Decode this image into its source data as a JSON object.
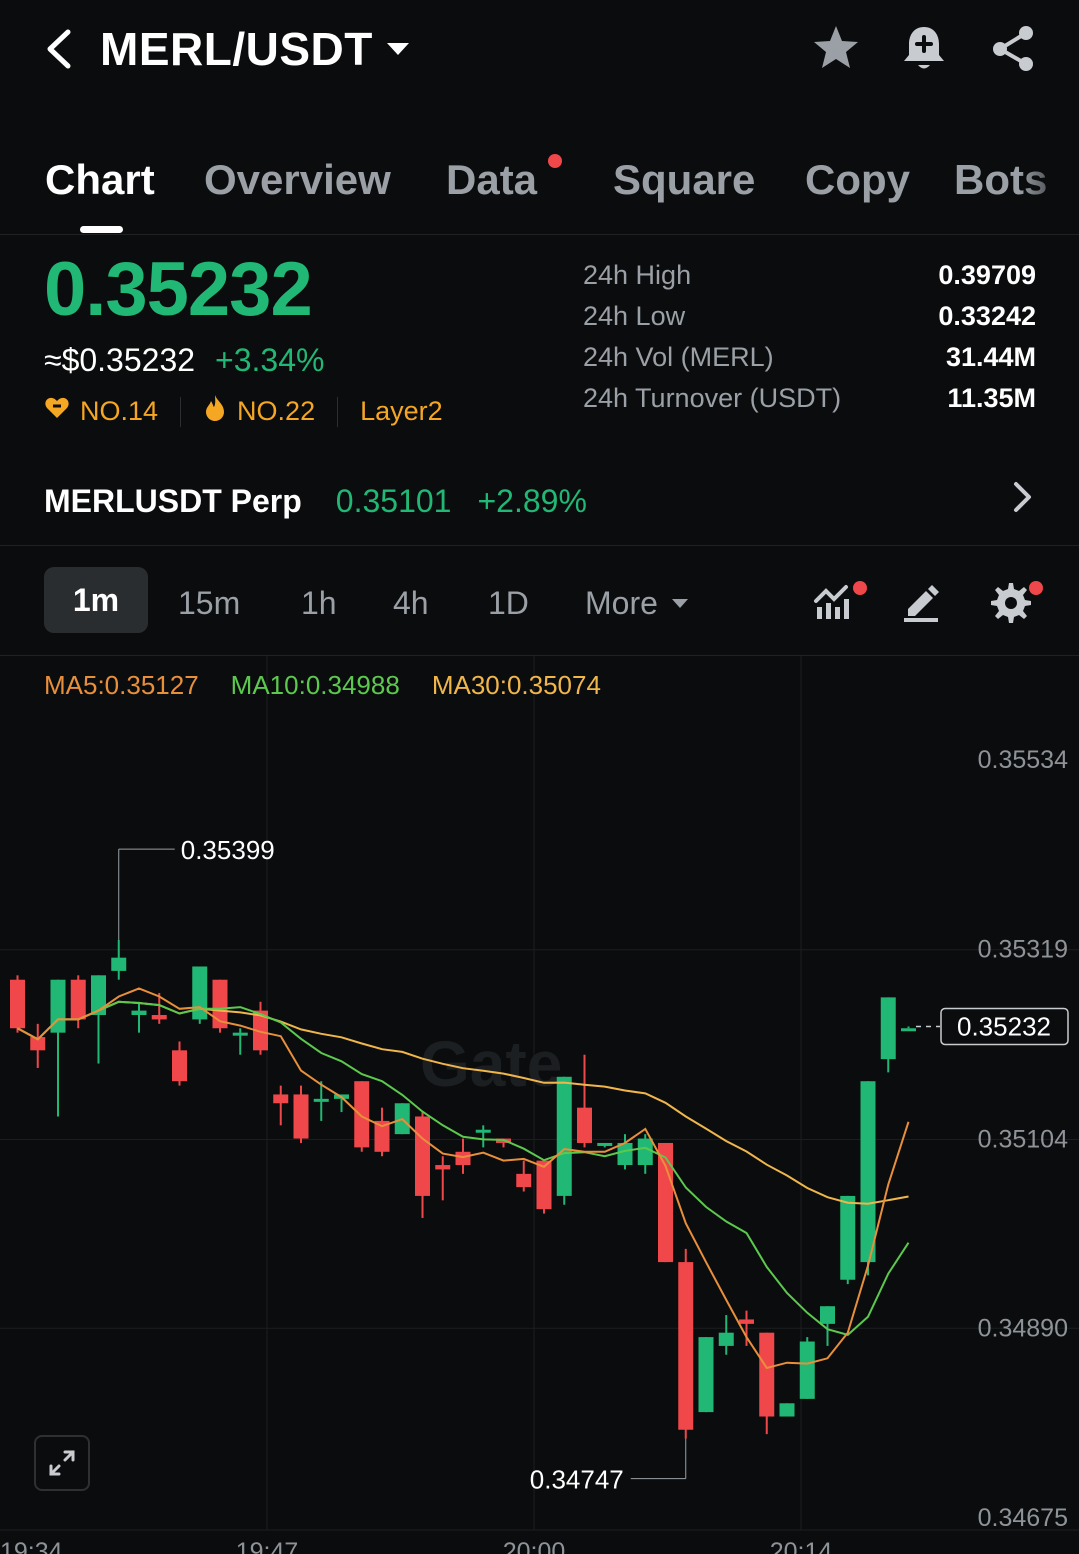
{
  "header": {
    "pair": "MERL/USDT",
    "icons": [
      "back-icon",
      "star-icon",
      "bell-plus-icon",
      "share-icon"
    ]
  },
  "tabs": [
    "Chart",
    "Overview",
    "Data",
    "Square",
    "Copy",
    "Bots"
  ],
  "active_tab": "Chart",
  "price": {
    "last": "0.35232",
    "usd": "≈$0.35232",
    "change": "+3.34%",
    "rank1": "NO.14",
    "rank2": "NO.22",
    "tag": "Layer2"
  },
  "stats": [
    {
      "label": "24h High",
      "value": "0.39709"
    },
    {
      "label": "24h Low",
      "value": "0.33242"
    },
    {
      "label": "24h Vol (MERL)",
      "value": "31.44M"
    },
    {
      "label": "24h Turnover (USDT)",
      "value": "11.35M"
    }
  ],
  "perp": {
    "name": "MERLUSDT Perp",
    "price": "0.35101",
    "change": "+2.89%"
  },
  "intervals": [
    "1m",
    "15m",
    "1h",
    "4h",
    "1D",
    "More"
  ],
  "active_interval": "1m",
  "ma_legend": {
    "ma5": "MA5:0.35127",
    "ma10": "MA10:0.34988",
    "ma30": "MA30:0.35074"
  },
  "colors": {
    "up": "#21b775",
    "down": "#f0474b",
    "accent": "#f5a623",
    "ma5": "#e88f3c",
    "ma10": "#5cc94e",
    "ma30": "#f0b64b"
  },
  "chart_data": {
    "type": "candlestick",
    "y_axis_labels": [
      "0.35534",
      "0.35319",
      "0.35104",
      "0.34890",
      "0.34675"
    ],
    "x_axis_labels": [
      "19:34",
      "19:47",
      "20:00",
      "20:14"
    ],
    "ylim": [
      0.34675,
      0.35534
    ],
    "current_price_label": "0.35232",
    "high_marker": "0.35399",
    "low_marker": "0.34747",
    "watermark": "Gate",
    "candles": [
      [
        0.35285,
        0.3529,
        0.3523,
        0.35225
      ],
      [
        0.3522,
        0.35235,
        0.35205,
        0.35185
      ],
      [
        0.35225,
        0.35285,
        0.35285,
        0.3513
      ],
      [
        0.35285,
        0.3529,
        0.3524,
        0.3523
      ],
      [
        0.35245,
        0.3529,
        0.3529,
        0.3519
      ],
      [
        0.35295,
        0.3533,
        0.3531,
        0.35285
      ],
      [
        0.35245,
        0.3526,
        0.3525,
        0.35225
      ],
      [
        0.35245,
        0.3527,
        0.3524,
        0.35235
      ],
      [
        0.35205,
        0.35215,
        0.3517,
        0.35165
      ],
      [
        0.3524,
        0.353,
        0.353,
        0.35235
      ],
      [
        0.35285,
        0.35285,
        0.3523,
        0.35225
      ],
      [
        0.35225,
        0.3523,
        0.35225,
        0.352
      ],
      [
        0.3525,
        0.3526,
        0.35205,
        0.352
      ],
      [
        0.35155,
        0.35165,
        0.35145,
        0.3512
      ],
      [
        0.35155,
        0.35165,
        0.35105,
        0.351
      ],
      [
        0.3515,
        0.3517,
        0.3515,
        0.35125
      ],
      [
        0.3515,
        0.3515,
        0.35155,
        0.35135
      ],
      [
        0.3517,
        0.3517,
        0.35095,
        0.3509
      ],
      [
        0.35125,
        0.3514,
        0.3509,
        0.35085
      ],
      [
        0.3511,
        0.35145,
        0.35145,
        0.3511
      ],
      [
        0.3513,
        0.35135,
        0.3504,
        0.35015
      ],
      [
        0.35075,
        0.35085,
        0.3507,
        0.35035
      ],
      [
        0.3509,
        0.35105,
        0.35075,
        0.35065
      ],
      [
        0.35115,
        0.3512,
        0.35115,
        0.35095
      ],
      [
        0.35105,
        0.35105,
        0.351,
        0.35095
      ],
      [
        0.35065,
        0.3508,
        0.3505,
        0.35045
      ],
      [
        0.3508,
        0.3508,
        0.35025,
        0.3502
      ],
      [
        0.3504,
        0.35175,
        0.35175,
        0.3503
      ],
      [
        0.3514,
        0.352,
        0.351,
        0.35095
      ],
      [
        0.351,
        0.351,
        0.351,
        0.35095
      ],
      [
        0.35075,
        0.3511,
        0.351,
        0.3507
      ],
      [
        0.35075,
        0.3511,
        0.35105,
        0.35065
      ],
      [
        0.351,
        0.351,
        0.34965,
        0.34965
      ],
      [
        0.34965,
        0.3498,
        0.34775,
        0.34765
      ],
      [
        0.34795,
        0.3488,
        0.3488,
        0.34795
      ],
      [
        0.3487,
        0.34905,
        0.34885,
        0.3486
      ],
      [
        0.349,
        0.3491,
        0.34895,
        0.3487
      ],
      [
        0.34885,
        0.34885,
        0.3479,
        0.3477
      ],
      [
        0.3479,
        0.34805,
        0.34805,
        0.3479
      ],
      [
        0.3481,
        0.3488,
        0.34875,
        0.3481
      ],
      [
        0.34895,
        0.34915,
        0.34915,
        0.3487
      ],
      [
        0.34945,
        0.3504,
        0.3504,
        0.3494
      ],
      [
        0.34965,
        0.3517,
        0.3517,
        0.3495
      ],
      [
        0.35195,
        0.35265,
        0.35265,
        0.3518
      ],
      [
        0.3523,
        0.35232,
        0.3523,
        0.3523
      ]
    ]
  }
}
